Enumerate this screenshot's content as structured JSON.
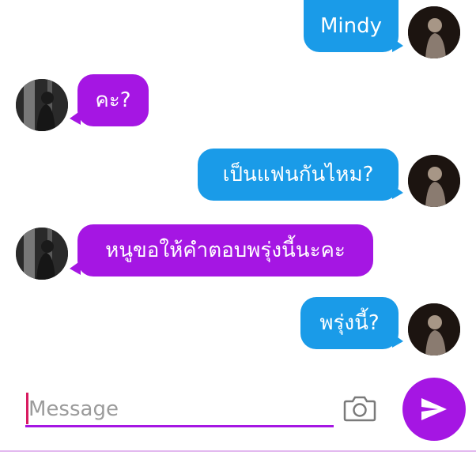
{
  "messages": [
    {
      "text": "Mindy",
      "direction": "sent"
    },
    {
      "text": "คะ?",
      "direction": "received"
    },
    {
      "text": "เป็นแฟนกันไหม?",
      "direction": "sent"
    },
    {
      "text": "หนูขอให้คำตอบพรุ่งนี้นะคะ",
      "direction": "received"
    },
    {
      "text": "พรุ่งนี้?",
      "direction": "sent"
    }
  ],
  "composer": {
    "placeholder": "Message",
    "camera_icon": "camera-icon",
    "send_icon": "send-icon"
  },
  "colors": {
    "sent_bubble": "#1a9be8",
    "received_bubble": "#a516e3",
    "accent": "#a516e3",
    "cursor": "#d81b60"
  }
}
